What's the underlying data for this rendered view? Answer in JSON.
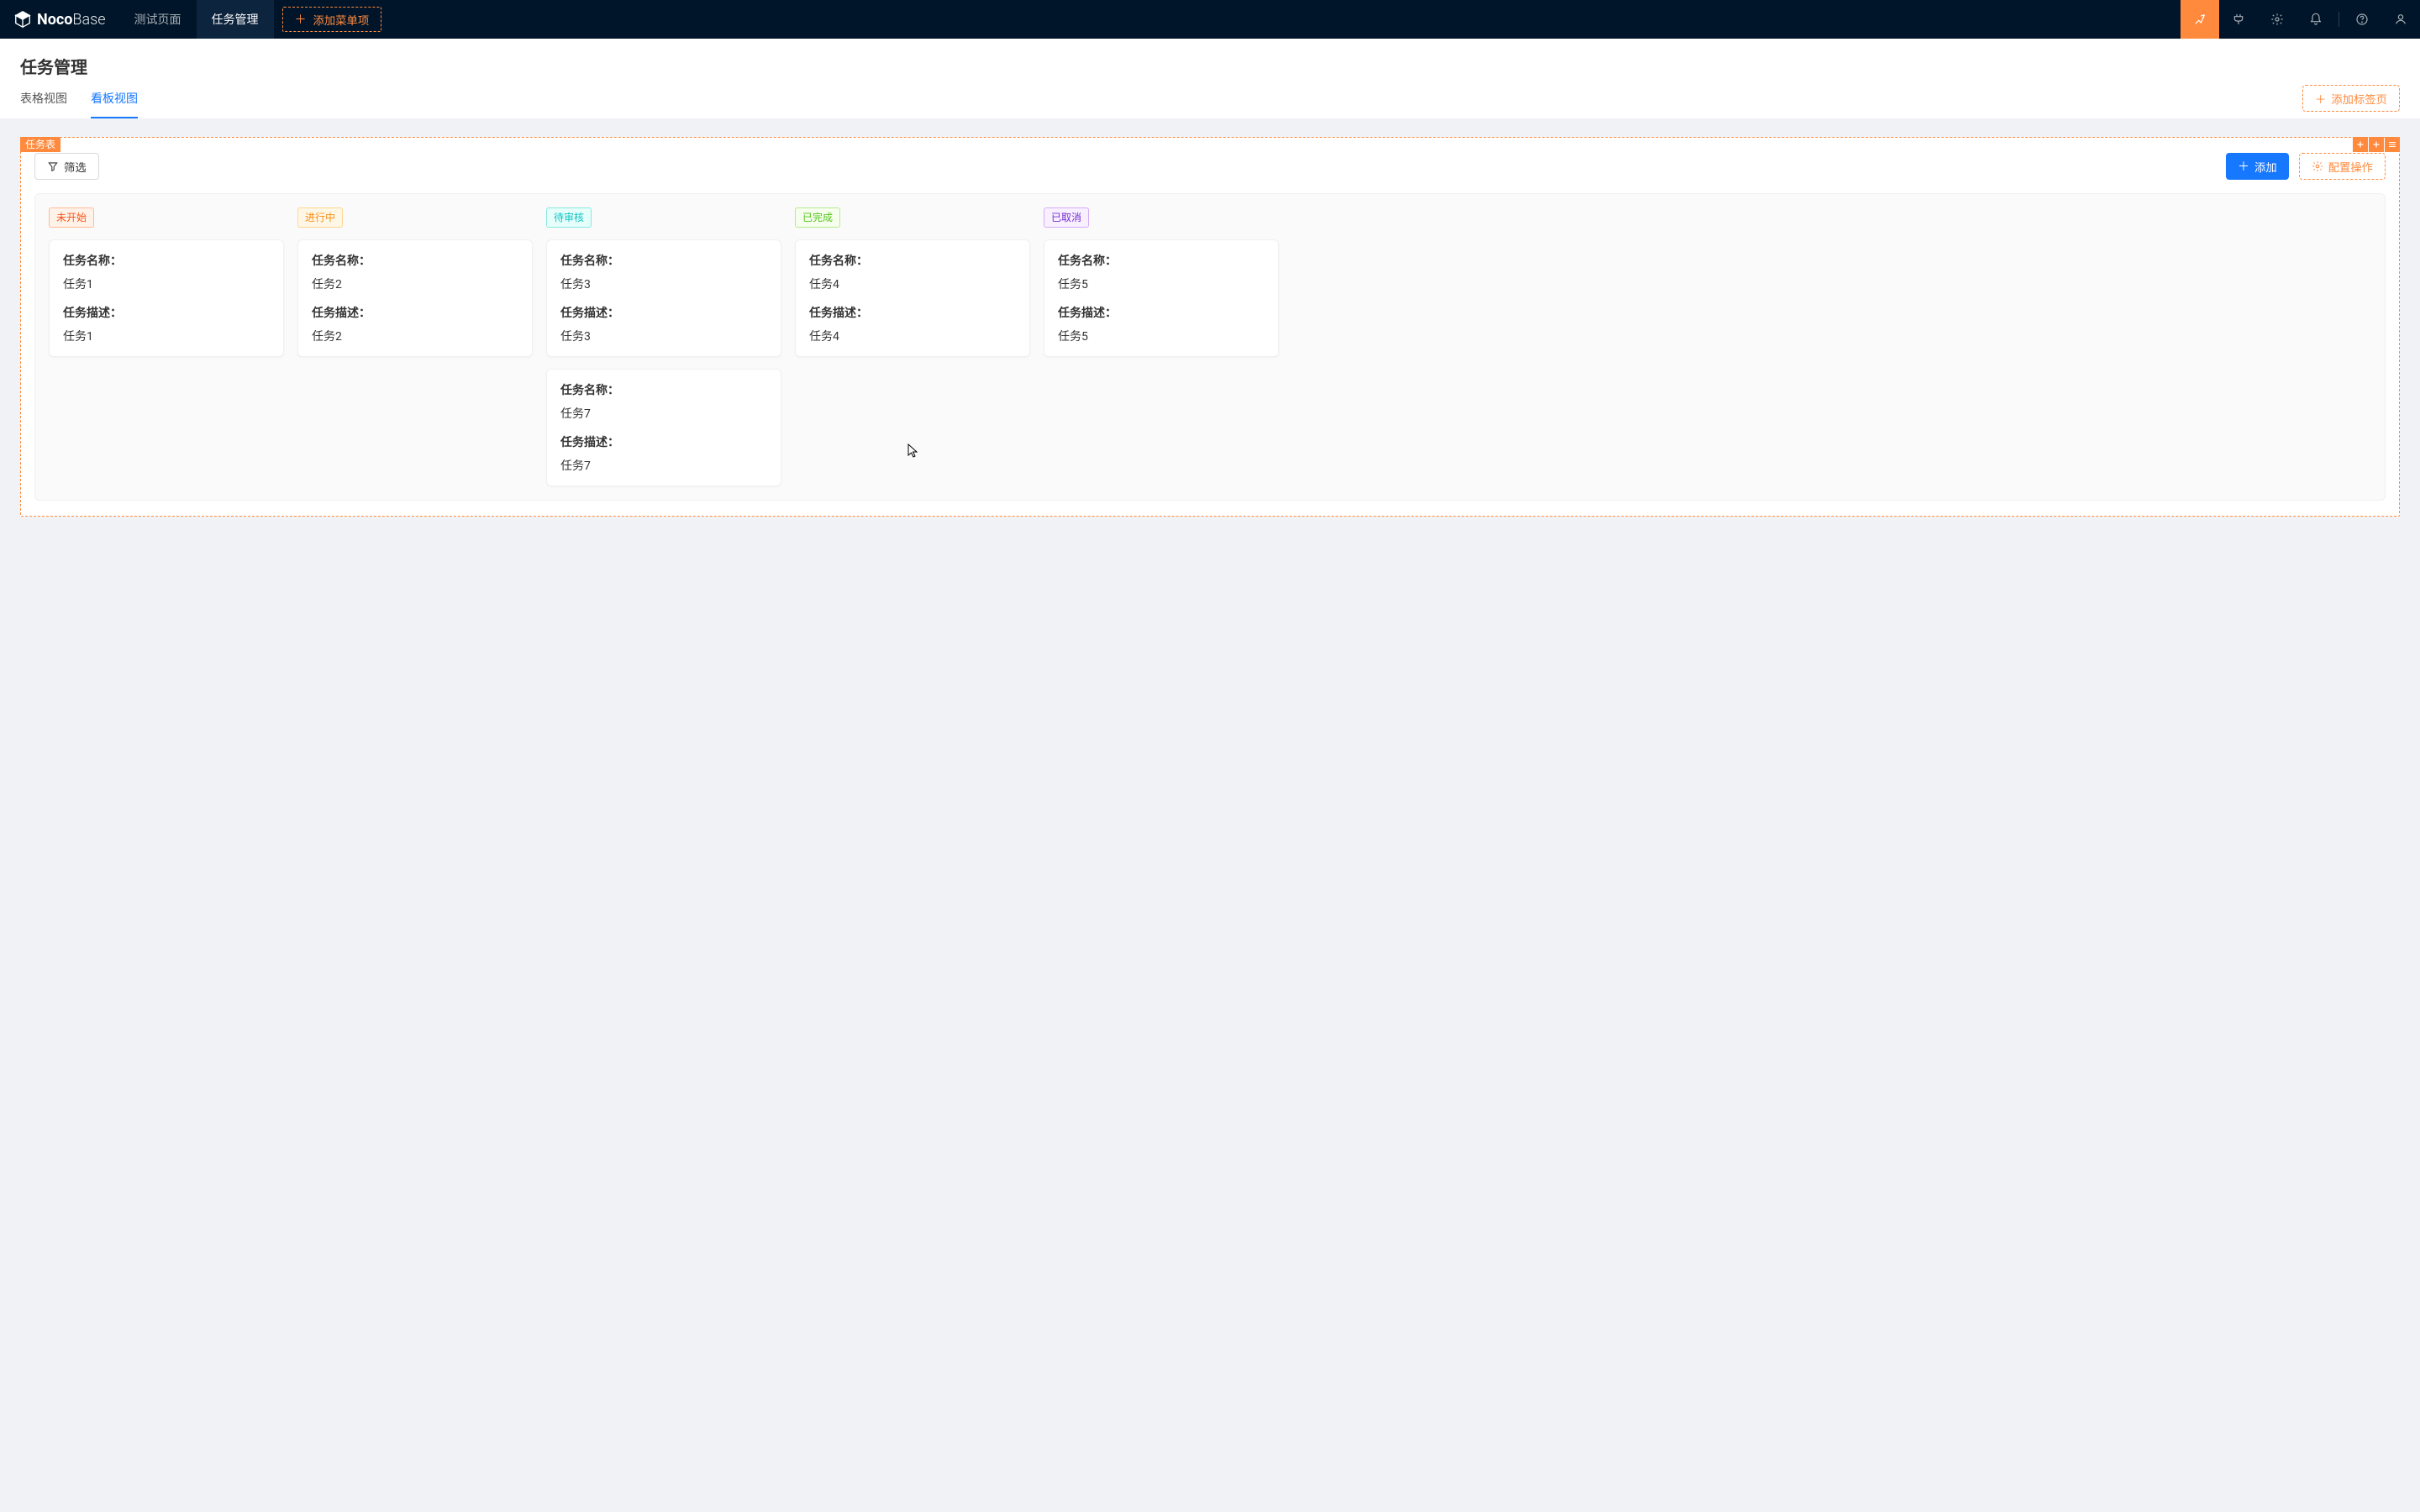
{
  "logo": {
    "noco": "Noco",
    "base": "Base"
  },
  "topNav": {
    "items": [
      "测试页面",
      "任务管理"
    ],
    "activeIndex": 1,
    "addMenu": "添加菜单项"
  },
  "page": {
    "title": "任务管理",
    "tabs": [
      "表格视图",
      "看板视图"
    ],
    "activeTabIndex": 1,
    "addTab": "添加标签页"
  },
  "block": {
    "tag": "任务表",
    "filter": "筛选",
    "add": "添加",
    "config": "配置操作"
  },
  "kanban": {
    "fieldLabels": {
      "name": "任务名称：",
      "desc": "任务描述："
    },
    "columns": [
      {
        "label": "未开始",
        "bg": "#fff2e8",
        "border": "#ffbb96",
        "color": "#fa541c",
        "cards": [
          {
            "name": "任务1",
            "desc": "任务1"
          }
        ]
      },
      {
        "label": "进行中",
        "bg": "#fff7e6",
        "border": "#ffd591",
        "color": "#fa8c16",
        "cards": [
          {
            "name": "任务2",
            "desc": "任务2"
          }
        ]
      },
      {
        "label": "待审核",
        "bg": "#e6fffb",
        "border": "#87e8de",
        "color": "#13c2c2",
        "cards": [
          {
            "name": "任务3",
            "desc": "任务3"
          },
          {
            "name": "任务7",
            "desc": "任务7"
          }
        ]
      },
      {
        "label": "已完成",
        "bg": "#f6ffed",
        "border": "#b7eb8f",
        "color": "#52c41a",
        "cards": [
          {
            "name": "任务4",
            "desc": "任务4"
          }
        ]
      },
      {
        "label": "已取消",
        "bg": "#f9f0ff",
        "border": "#d3adf7",
        "color": "#722ed1",
        "cards": [
          {
            "name": "任务5",
            "desc": "任务5"
          }
        ]
      }
    ]
  },
  "colors": {
    "accent": "#ff8a3d",
    "primary": "#1677ff",
    "headerBg": "#001529"
  }
}
